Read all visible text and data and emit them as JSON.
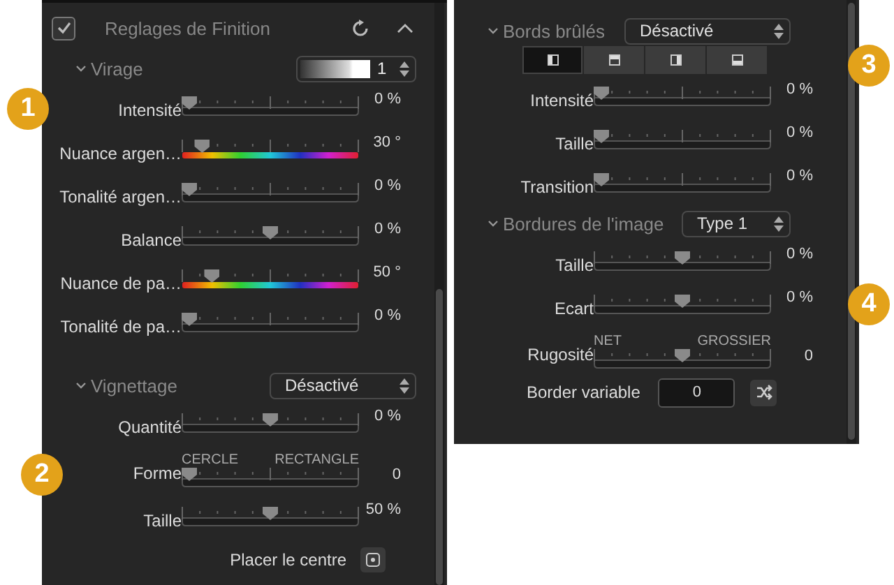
{
  "left_panel": {
    "header": {
      "title": "Reglages de Finition",
      "checked": true
    },
    "sections": [
      {
        "title": "Virage",
        "expanded": true,
        "control": {
          "kind": "gradient-spinner",
          "value": "1"
        },
        "rows": [
          {
            "kind": "slider",
            "label": "Intensité",
            "level": 0,
            "reading": "0 %"
          },
          {
            "kind": "hue-slider",
            "label": "Nuance argen…",
            "level": 0.08,
            "reading": "30 °"
          },
          {
            "kind": "slider",
            "label": "Tonalité argen…",
            "level": 0,
            "reading": "0 %"
          },
          {
            "kind": "slider",
            "label": "Balance",
            "level": 0.5,
            "reading": "0 %"
          },
          {
            "kind": "hue-slider",
            "label": "Nuance de pa…",
            "level": 0.14,
            "reading": "50 °"
          },
          {
            "kind": "slider",
            "label": "Tonalité de pa…",
            "level": 0,
            "reading": "0 %"
          }
        ]
      },
      {
        "title": "Vignettage",
        "expanded": true,
        "control": {
          "kind": "dropdown",
          "value": "Désactivé"
        },
        "rows": [
          {
            "kind": "slider",
            "label": "Quantité",
            "level": 0.5,
            "reading": "0 %"
          },
          {
            "kind": "slider",
            "label": "Forme",
            "level": 0,
            "reading": "0",
            "scale_labels": [
              "CERCLE",
              "RECTANGLE"
            ]
          },
          {
            "kind": "slider",
            "label": "Taille",
            "level": 0.5,
            "reading": "50 %"
          },
          {
            "kind": "button",
            "label": "Placer le centre"
          }
        ]
      }
    ]
  },
  "right_panel": {
    "sections": [
      {
        "title": "Bords brûlés",
        "expanded": true,
        "control": {
          "kind": "dropdown",
          "value": "Désactivé"
        },
        "segments": [
          {
            "kind": "left",
            "selected": true
          },
          {
            "kind": "top",
            "selected": false
          },
          {
            "kind": "right",
            "selected": false
          },
          {
            "kind": "bottom",
            "selected": false
          }
        ],
        "rows": [
          {
            "kind": "slider",
            "label": "Intensité",
            "level": 0,
            "reading": "0 %"
          },
          {
            "kind": "slider",
            "label": "Taille",
            "level": 0,
            "reading": "0 %"
          },
          {
            "kind": "slider",
            "label": "Transition",
            "level": 0,
            "reading": "0 %"
          }
        ]
      },
      {
        "title": "Bordures de l'image",
        "expanded": true,
        "control": {
          "kind": "dropdown",
          "value": "Type 1"
        },
        "rows": [
          {
            "kind": "slider",
            "label": "Taille",
            "level": 0.5,
            "reading": "0 %"
          },
          {
            "kind": "slider",
            "label": "Ecart",
            "level": 0.5,
            "reading": "0 %"
          },
          {
            "kind": "slider",
            "label": "Rugosité",
            "level": 0.5,
            "reading": "0",
            "scale_labels": [
              "NET",
              "GROSSIER"
            ]
          },
          {
            "kind": "field",
            "label": "Border variable",
            "value": "0"
          }
        ]
      }
    ]
  },
  "badges": [
    "1",
    "2",
    "3",
    "4"
  ]
}
